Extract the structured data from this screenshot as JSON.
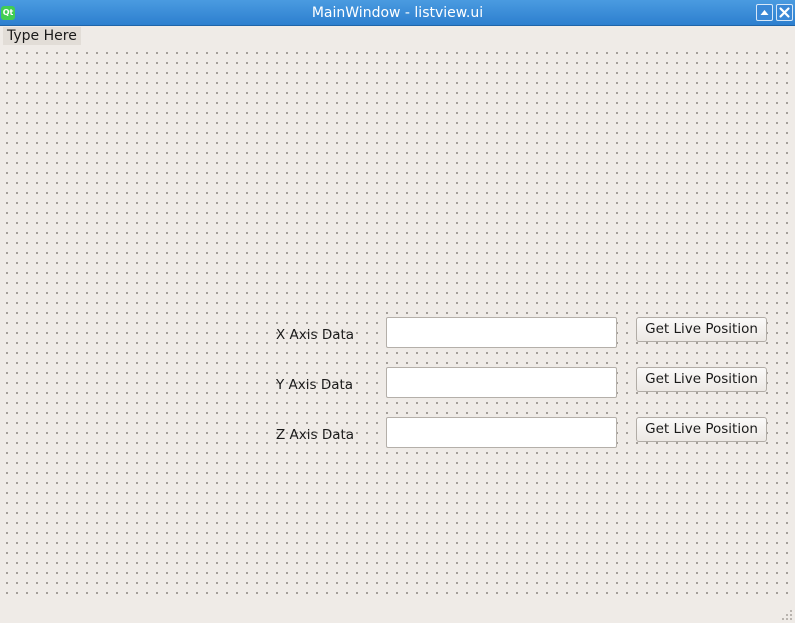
{
  "window": {
    "title": "MainWindow - listview.ui",
    "app_icon_text": "Qt"
  },
  "titlebar_buttons": {
    "maximize_icon": "triangle-up-icon",
    "close_icon": "x-close-icon"
  },
  "menubar": {
    "items": [
      {
        "label": "Type Here"
      }
    ]
  },
  "form": {
    "rows": [
      {
        "label": "X Axis Data",
        "value": "",
        "button_label": "Get Live Position"
      },
      {
        "label": "Y Axis Data",
        "value": "",
        "button_label": "Get Live Position"
      },
      {
        "label": "Z Axis Data",
        "value": "",
        "button_label": "Get Live Position"
      }
    ]
  },
  "colors": {
    "titlebar": "#2d7fcf",
    "background": "#efebe7",
    "grid_dot": "#8f8a84"
  }
}
